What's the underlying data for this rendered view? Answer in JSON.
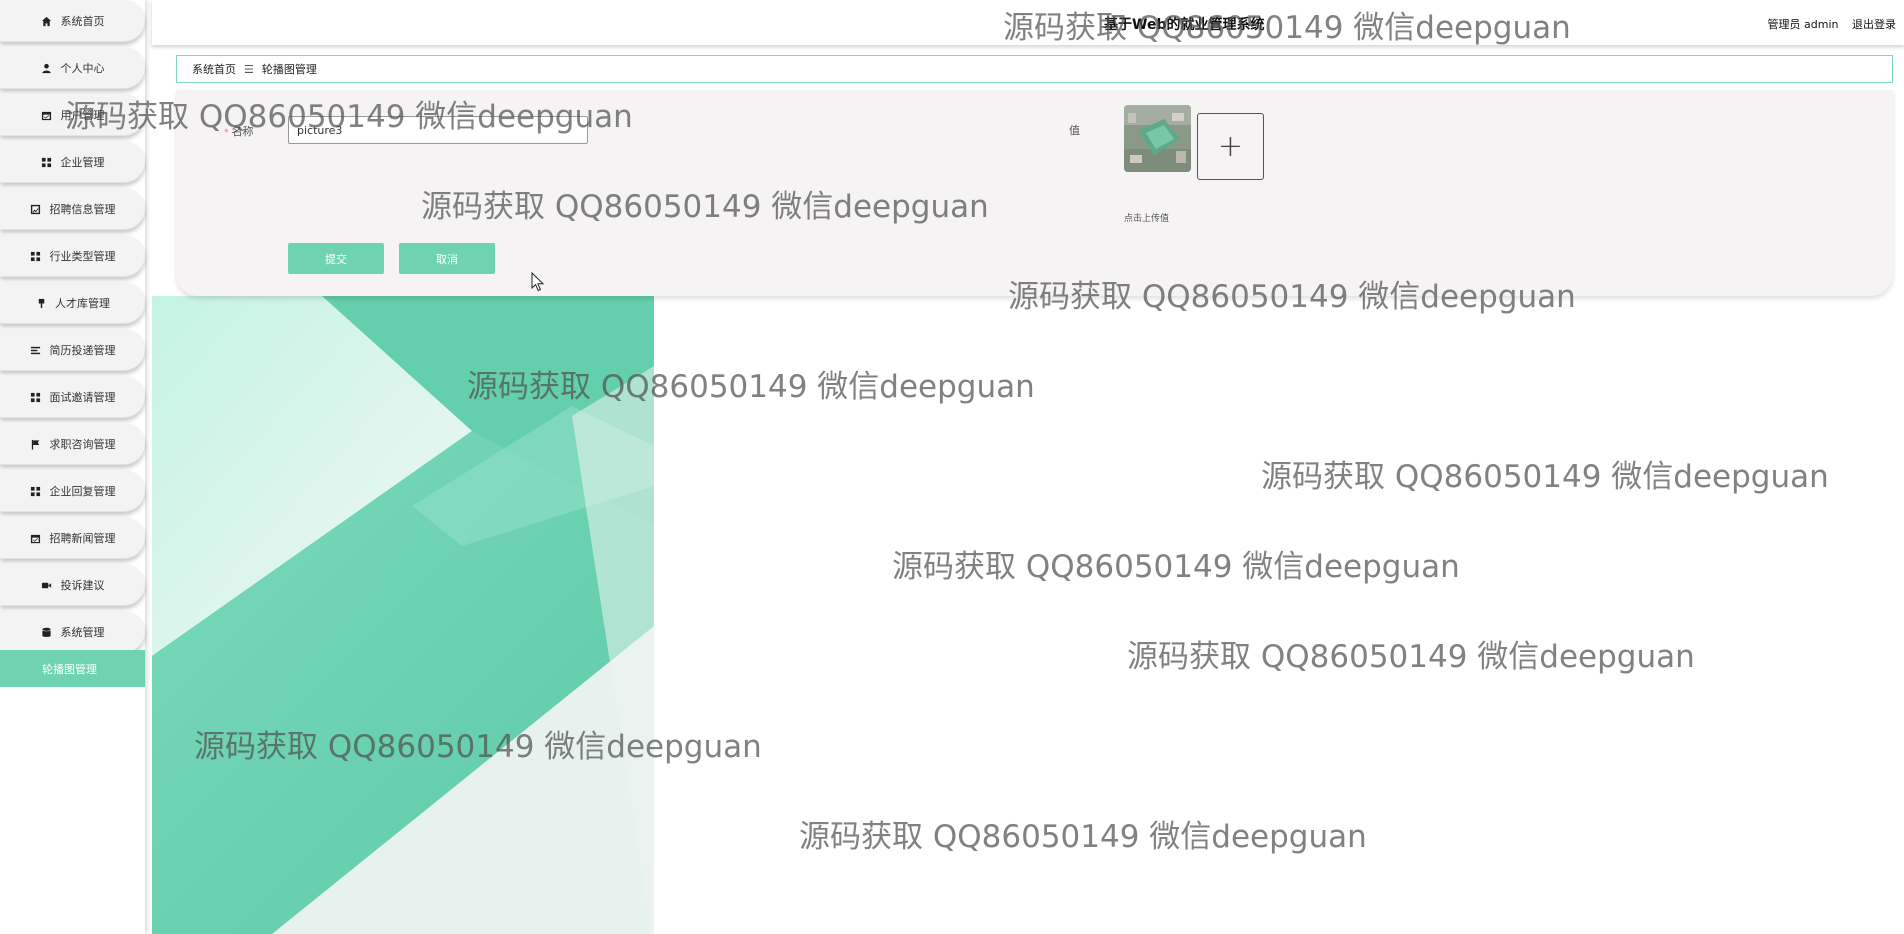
{
  "app": {
    "title": "基于Web的就业管理系统",
    "user_label": "管理员 admin",
    "logout_label": "退出登录"
  },
  "sidebar": {
    "items": [
      {
        "label": "系统首页",
        "icon": "home-icon"
      },
      {
        "label": "个人中心",
        "icon": "user-icon"
      },
      {
        "label": "用户管理",
        "icon": "calendar-check-icon"
      },
      {
        "label": "企业管理",
        "icon": "grid-icon"
      },
      {
        "label": "招聘信息管理",
        "icon": "chart-icon"
      },
      {
        "label": "行业类型管理",
        "icon": "grid-icon"
      },
      {
        "label": "人才库管理",
        "icon": "pin-icon"
      },
      {
        "label": "简历投递管理",
        "icon": "list-icon"
      },
      {
        "label": "面试邀请管理",
        "icon": "grid-icon"
      },
      {
        "label": "求职咨询管理",
        "icon": "flag-icon"
      },
      {
        "label": "企业回复管理",
        "icon": "grid-icon"
      },
      {
        "label": "招聘新闻管理",
        "icon": "calendar-check-icon"
      },
      {
        "label": "投诉建议",
        "icon": "video-icon"
      },
      {
        "label": "系统管理",
        "icon": "database-icon"
      }
    ],
    "active_sub_item": "轮播图管理"
  },
  "breadcrumb": {
    "home": "系统首页",
    "separator": "☰",
    "current": "轮播图管理"
  },
  "form": {
    "name_label": "名称",
    "name_value": "picture3",
    "value_label": "值",
    "upload_hint": "点击上传值",
    "submit_label": "提交",
    "cancel_label": "取消"
  },
  "watermark_text": "源码获取 QQ86050149 微信deepguan",
  "colors": {
    "accent": "#6fd3b2",
    "breadcrumb_border": "#7fd9bf",
    "panel_bg": "#f5f3f3",
    "required": "#f56c6c"
  }
}
